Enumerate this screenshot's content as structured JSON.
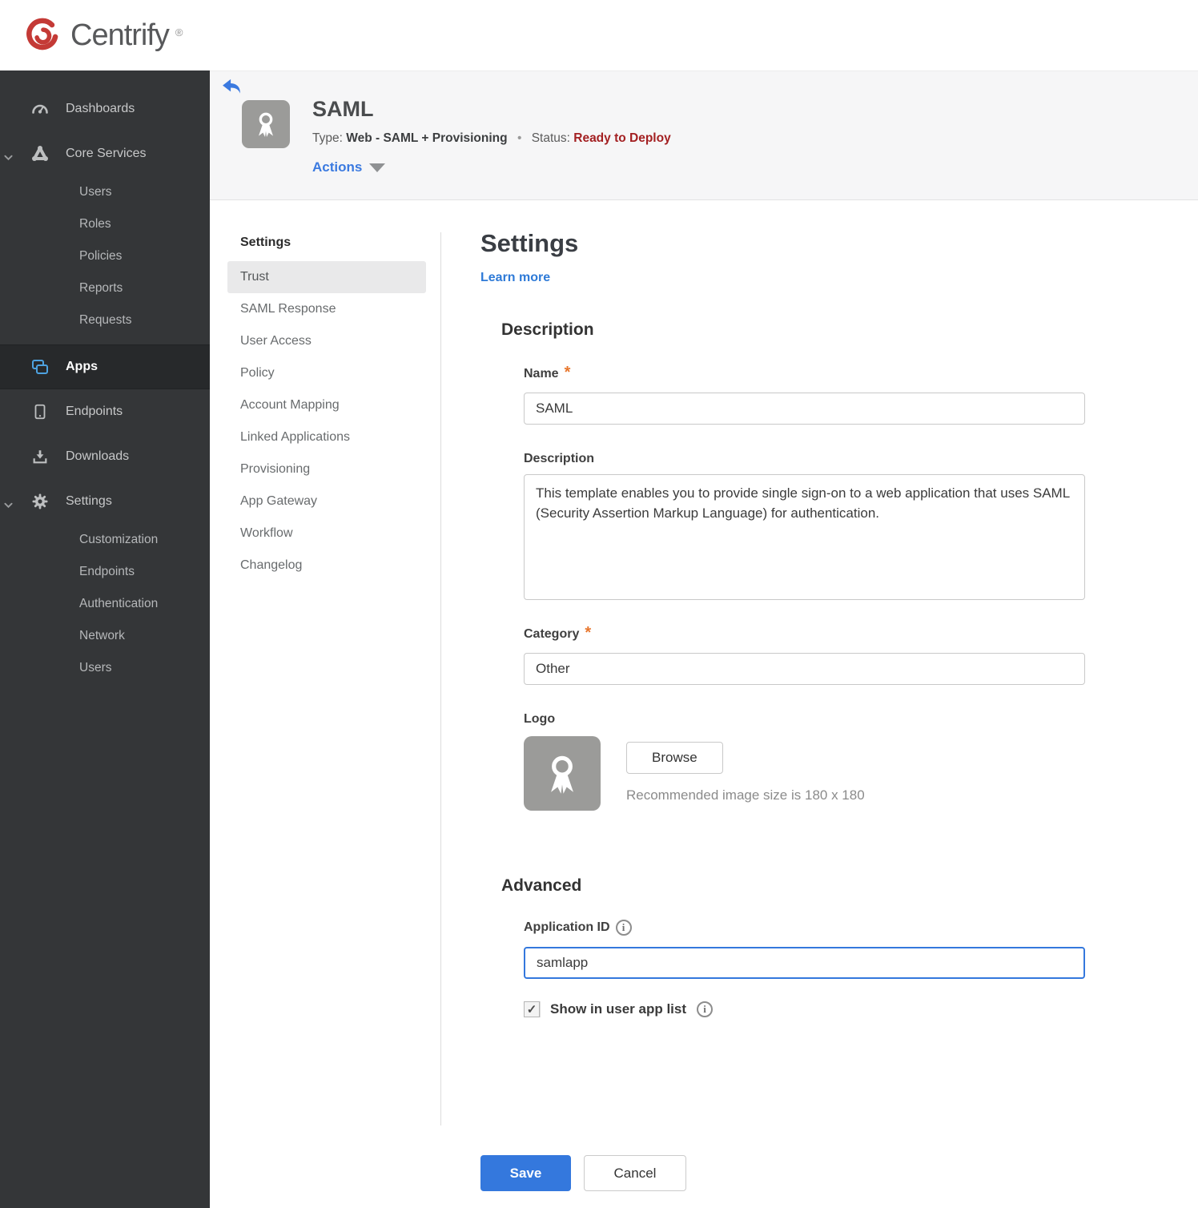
{
  "brand": {
    "name": "Centrify",
    "registered_mark": "®"
  },
  "sidebar": {
    "items": [
      {
        "label": "Dashboards"
      },
      {
        "label": "Core Services"
      },
      {
        "label": "Users"
      },
      {
        "label": "Roles"
      },
      {
        "label": "Policies"
      },
      {
        "label": "Reports"
      },
      {
        "label": "Requests"
      },
      {
        "label": "Apps"
      },
      {
        "label": "Endpoints"
      },
      {
        "label": "Downloads"
      },
      {
        "label": "Settings"
      },
      {
        "label": "Customization"
      },
      {
        "label": "Endpoints"
      },
      {
        "label": "Authentication"
      },
      {
        "label": "Network"
      },
      {
        "label": "Users"
      }
    ]
  },
  "app_header": {
    "title": "SAML",
    "type_label": "Type:",
    "type_value": "Web - SAML + Provisioning",
    "separator": "•",
    "status_label": "Status:",
    "status_value": "Ready to Deploy",
    "actions_label": "Actions"
  },
  "subnav": {
    "title": "Settings",
    "selected": "Trust",
    "items": [
      "Trust",
      "SAML Response",
      "User Access",
      "Policy",
      "Account Mapping",
      "Linked Applications",
      "Provisioning",
      "App Gateway",
      "Workflow",
      "Changelog"
    ]
  },
  "main": {
    "title": "Settings",
    "learn_more": "Learn more",
    "required_marker": "*",
    "description": {
      "heading": "Description",
      "name_label": "Name",
      "name_value": "SAML",
      "description_label": "Description",
      "description_value": "This template enables you to provide single sign-on to a web application that uses SAML (Security Assertion Markup Language) for authentication.",
      "category_label": "Category",
      "category_value": "Other",
      "logo_label": "Logo",
      "browse_label": "Browse",
      "size_hint": "Recommended image size is 180 x 180"
    },
    "advanced": {
      "heading": "Advanced",
      "application_id_label": "Application ID",
      "application_id_value": "samlapp",
      "show_in_app_list_label": "Show in user app list",
      "checkbox_checked_glyph": "✓"
    },
    "footer": {
      "save_label": "Save",
      "cancel_label": "Cancel"
    }
  },
  "icons": {
    "info_glyph": "i"
  },
  "colors": {
    "accent_blue": "#3478dd",
    "link_blue": "#2e7ad7",
    "status_red": "#a32022",
    "sidebar_bg": "#343638",
    "sidebar_active_bg": "#27292b",
    "app_icon_blue": "#4da2e0",
    "header_band_bg": "#f6f6f7",
    "required_orange": "#e8772e"
  }
}
